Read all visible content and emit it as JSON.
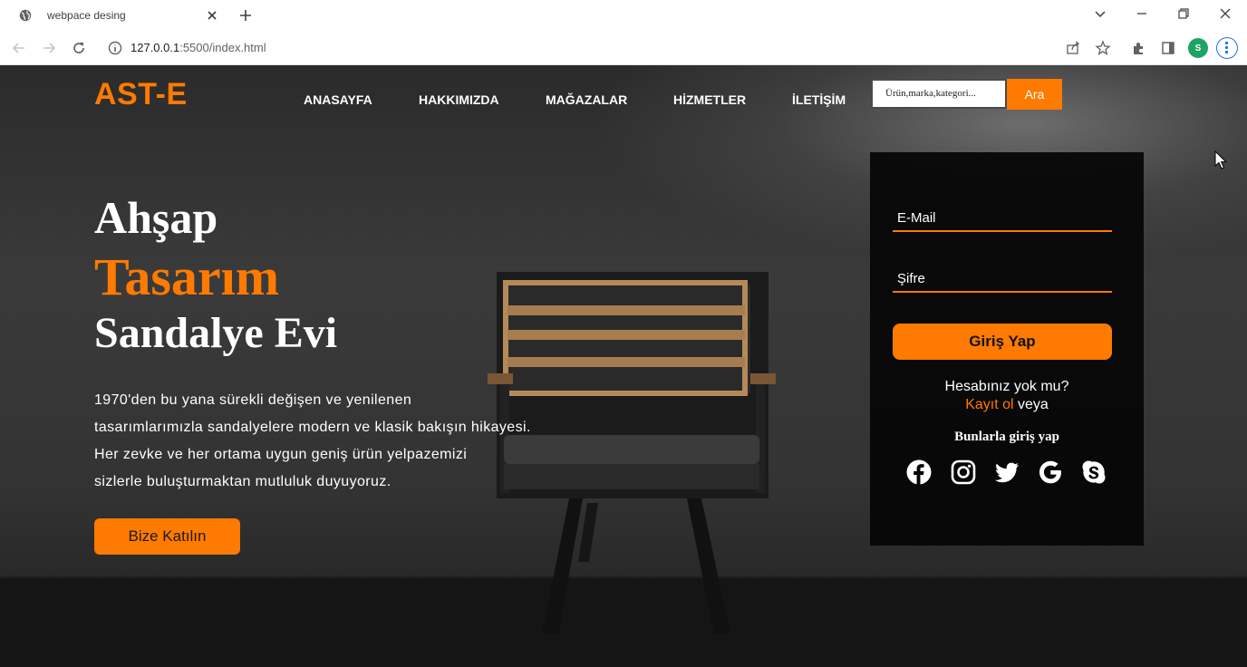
{
  "browser": {
    "tab_title": "webpace desing",
    "url_host": "127.0.0.1",
    "url_rest": ":5500/index.html",
    "profile_initial": "S"
  },
  "header": {
    "logo": "AST-E",
    "nav": [
      "ANASAYFA",
      "HAKKIMIZDA",
      "MAĞAZALAR",
      "HİZMETLER",
      "İLETİŞİM"
    ],
    "search_placeholder": "Ürün,marka,kategori...",
    "search_button": "Ara"
  },
  "hero": {
    "line1": "Ahşap",
    "line2": "Tasarım",
    "line3": "Sandalye Evi",
    "description": [
      "1970'den bu yana sürekli değişen ve yenilenen",
      "tasarımlarımızla sandalyelere modern ve klasik bakışın hikayesi.",
      "Her zevke ve her ortama uygun geniş ürün yelpazemizi",
      "sizlerle buluşturmaktan mutluluk duyuyoruz."
    ],
    "cta": "Bize Katılın"
  },
  "login": {
    "email_placeholder": "E-Mail",
    "password_placeholder": "Şifre",
    "submit": "Giriş Yap",
    "no_account": "Hesabınız yok mu?",
    "register": "Kayıt ol",
    "or": "veya",
    "social_title": "Bunlarla giriş yap",
    "social_icons": [
      "facebook-icon",
      "instagram-icon",
      "twitter-icon",
      "google-icon",
      "skype-icon"
    ]
  },
  "colors": {
    "accent": "#ff7a00",
    "panel": "#050505",
    "text": "#ffffff"
  }
}
